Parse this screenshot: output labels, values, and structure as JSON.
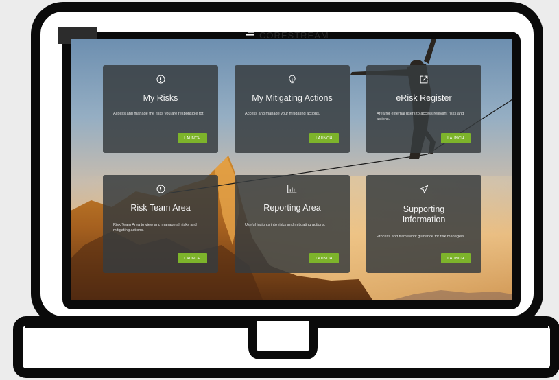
{
  "brand": {
    "name": "CORESTREAM"
  },
  "colors": {
    "launch_button": "#7db42b",
    "card_background": "#373c3e",
    "frame": "#0a0a0a"
  },
  "cards": [
    {
      "title": "My Risks",
      "description": "Access and manage the risks you are responsible for.",
      "button": "LAUNCH",
      "icon": "alert-circle-icon"
    },
    {
      "title": "My Mitigating Actions",
      "description": "Access and manage your mitigating actions.",
      "button": "LAUNCH",
      "icon": "lightbulb-icon"
    },
    {
      "title": "eRisk Register",
      "description": "Area for external users to access relevant risks and actions.",
      "button": "LAUNCH",
      "icon": "external-link-icon"
    },
    {
      "title": "Risk Team Area",
      "description": "Risk Team Area to view and manage all risks and mitigating actions.",
      "button": "LAUNCH",
      "icon": "alert-circle-icon"
    },
    {
      "title": "Reporting Area",
      "description": "Useful insights into risks and mitigating actions.",
      "button": "LAUNCH",
      "icon": "bar-chart-icon"
    },
    {
      "title": "Supporting Information",
      "description": "Process and framework guidance for risk managers.",
      "button": "LAUNCH",
      "icon": "send-arrow-icon"
    }
  ]
}
